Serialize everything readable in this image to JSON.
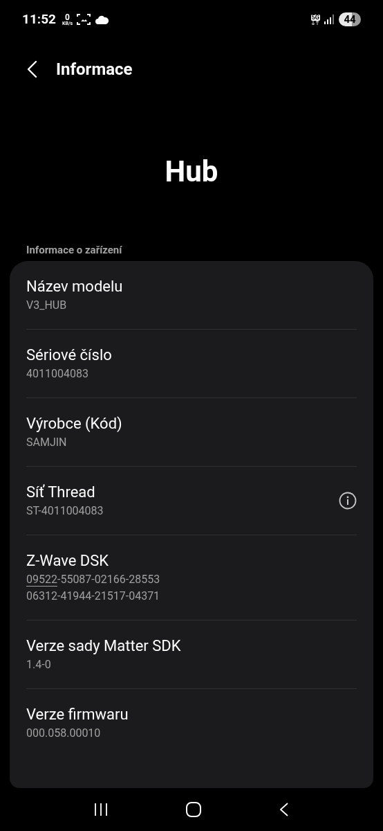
{
  "status_bar": {
    "time": "11:52",
    "speed_value": "0",
    "speed_unit": "KB/s",
    "network": "5G",
    "battery": "44"
  },
  "header": {
    "title": "Informace"
  },
  "device_name": "Hub",
  "section": {
    "title": "Informace o zařízení"
  },
  "rows": [
    {
      "label": "Název modelu",
      "lines": [
        [
          {
            "text": "V3_HUB",
            "underline": false
          }
        ]
      ],
      "info": false
    },
    {
      "label": "Sériové číslo",
      "lines": [
        [
          {
            "text": "4011004083",
            "underline": false
          }
        ]
      ],
      "info": false
    },
    {
      "label": "Výrobce (Kód)",
      "lines": [
        [
          {
            "text": "SAMJIN",
            "underline": false
          }
        ]
      ],
      "info": false
    },
    {
      "label": "Síť Thread",
      "lines": [
        [
          {
            "text": "ST-4011004083",
            "underline": false
          }
        ]
      ],
      "info": true
    },
    {
      "label": "Z-Wave DSK",
      "lines": [
        [
          {
            "text": "09522",
            "underline": true
          },
          {
            "text": "-55087-02166-28553",
            "underline": false
          }
        ],
        [
          {
            "text": "06312-41944-21517-04371",
            "underline": false
          }
        ]
      ],
      "info": false
    },
    {
      "label": "Verze sady Matter SDK",
      "lines": [
        [
          {
            "text": "1.4-0",
            "underline": false
          }
        ]
      ],
      "info": false
    },
    {
      "label": "Verze firmwaru",
      "lines": [
        [
          {
            "text": "000.058.00010",
            "underline": false
          }
        ]
      ],
      "info": false
    }
  ]
}
